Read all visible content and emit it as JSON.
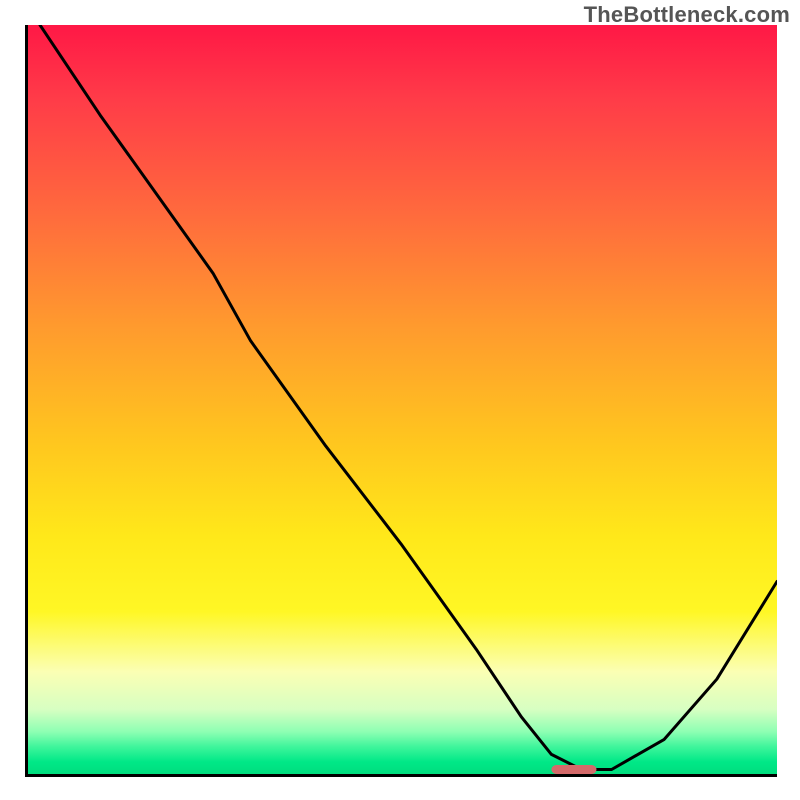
{
  "watermark": "TheBottleneck.com",
  "chart_data": {
    "type": "line",
    "title": "",
    "xlabel": "",
    "ylabel": "",
    "xlim": [
      0,
      100
    ],
    "ylim": [
      0,
      100
    ],
    "series": [
      {
        "name": "curve",
        "x": [
          2,
          10,
          20,
          25,
          30,
          40,
          50,
          60,
          66,
          70,
          74,
          78,
          85,
          92,
          100
        ],
        "y": [
          100,
          88,
          74,
          67,
          58,
          44,
          31,
          17,
          8,
          3,
          1,
          1,
          5,
          13,
          26
        ]
      }
    ],
    "marker": {
      "x": 73,
      "y": 1,
      "width": 6,
      "height": 1.2
    },
    "colors": {
      "curve": "#000000",
      "marker": "#d46a6a"
    }
  }
}
